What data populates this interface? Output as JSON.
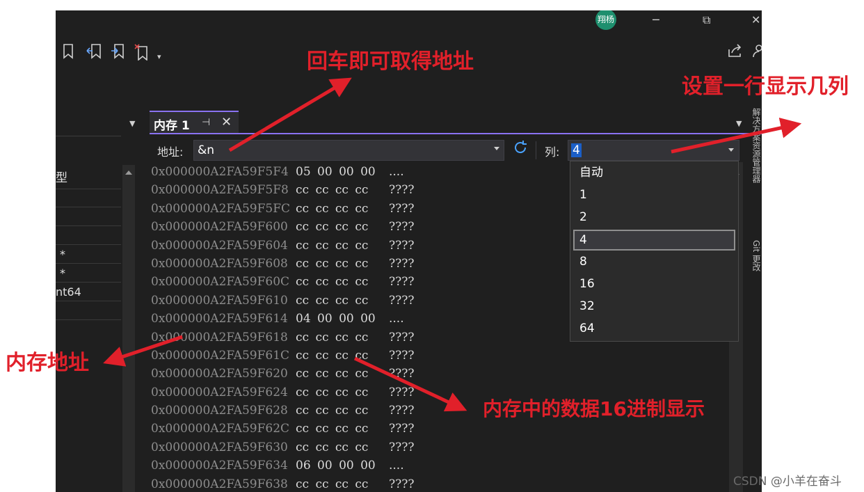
{
  "title_bar": {
    "avatar_text": "翔杨",
    "minimize_glyph": "─",
    "restore_glyph": "⧉",
    "close_glyph": "✕"
  },
  "toolbar": {
    "icons": [
      "bookmark-icon",
      "prev-bookmark-icon",
      "next-bookmark-icon",
      "clear-bookmarks-icon",
      "share-icon",
      "person-icon"
    ]
  },
  "left_panel": {
    "header": "型",
    "rows": [
      "",
      "",
      "",
      "*",
      "*",
      "nt64",
      ""
    ]
  },
  "memory_window": {
    "tab_title": "内存 1",
    "pin_glyph": "⊣",
    "close_glyph": "✕",
    "address_label": "地址:",
    "address_value": "&n",
    "columns_label": "列:",
    "columns_value": "4",
    "rows": [
      {
        "addr": "0x000000A2FA59F5F4",
        "bytes": "05 00 00 00",
        "chars": "...."
      },
      {
        "addr": "0x000000A2FA59F5F8",
        "bytes": "cc cc cc cc",
        "chars": "????"
      },
      {
        "addr": "0x000000A2FA59F5FC",
        "bytes": "cc cc cc cc",
        "chars": "????"
      },
      {
        "addr": "0x000000A2FA59F600",
        "bytes": "cc cc cc cc",
        "chars": "????"
      },
      {
        "addr": "0x000000A2FA59F604",
        "bytes": "cc cc cc cc",
        "chars": "????"
      },
      {
        "addr": "0x000000A2FA59F608",
        "bytes": "cc cc cc cc",
        "chars": "????"
      },
      {
        "addr": "0x000000A2FA59F60C",
        "bytes": "cc cc cc cc",
        "chars": "????"
      },
      {
        "addr": "0x000000A2FA59F610",
        "bytes": "cc cc cc cc",
        "chars": "????"
      },
      {
        "addr": "0x000000A2FA59F614",
        "bytes": "04 00 00 00",
        "chars": "...."
      },
      {
        "addr": "0x000000A2FA59F618",
        "bytes": "cc cc cc cc",
        "chars": "????"
      },
      {
        "addr": "0x000000A2FA59F61C",
        "bytes": "cc cc cc cc",
        "chars": "????"
      },
      {
        "addr": "0x000000A2FA59F620",
        "bytes": "cc cc cc cc",
        "chars": "????"
      },
      {
        "addr": "0x000000A2FA59F624",
        "bytes": "cc cc cc cc",
        "chars": "????"
      },
      {
        "addr": "0x000000A2FA59F628",
        "bytes": "cc cc cc cc",
        "chars": "????"
      },
      {
        "addr": "0x000000A2FA59F62C",
        "bytes": "cc cc cc cc",
        "chars": "????"
      },
      {
        "addr": "0x000000A2FA59F630",
        "bytes": "cc cc cc cc",
        "chars": "????"
      },
      {
        "addr": "0x000000A2FA59F634",
        "bytes": "06 00 00 00",
        "chars": "...."
      },
      {
        "addr": "0x000000A2FA59F638",
        "bytes": "cc cc cc cc",
        "chars": "????"
      }
    ],
    "column_options": [
      "自动",
      "1",
      "2",
      "4",
      "8",
      "16",
      "32",
      "64"
    ],
    "selected_option": "4"
  },
  "side_strip": {
    "texts": [
      "解决方案资源管理器",
      "Git 更改"
    ]
  },
  "annotations": {
    "enter_address": "回车即可取得地址",
    "set_columns": "设置一行显示几列",
    "memory_address": "内存地址",
    "hex_display": "内存中的数据16进制显示",
    "color": "#e1202a"
  },
  "watermark": "CSDN @小羊在奋斗"
}
